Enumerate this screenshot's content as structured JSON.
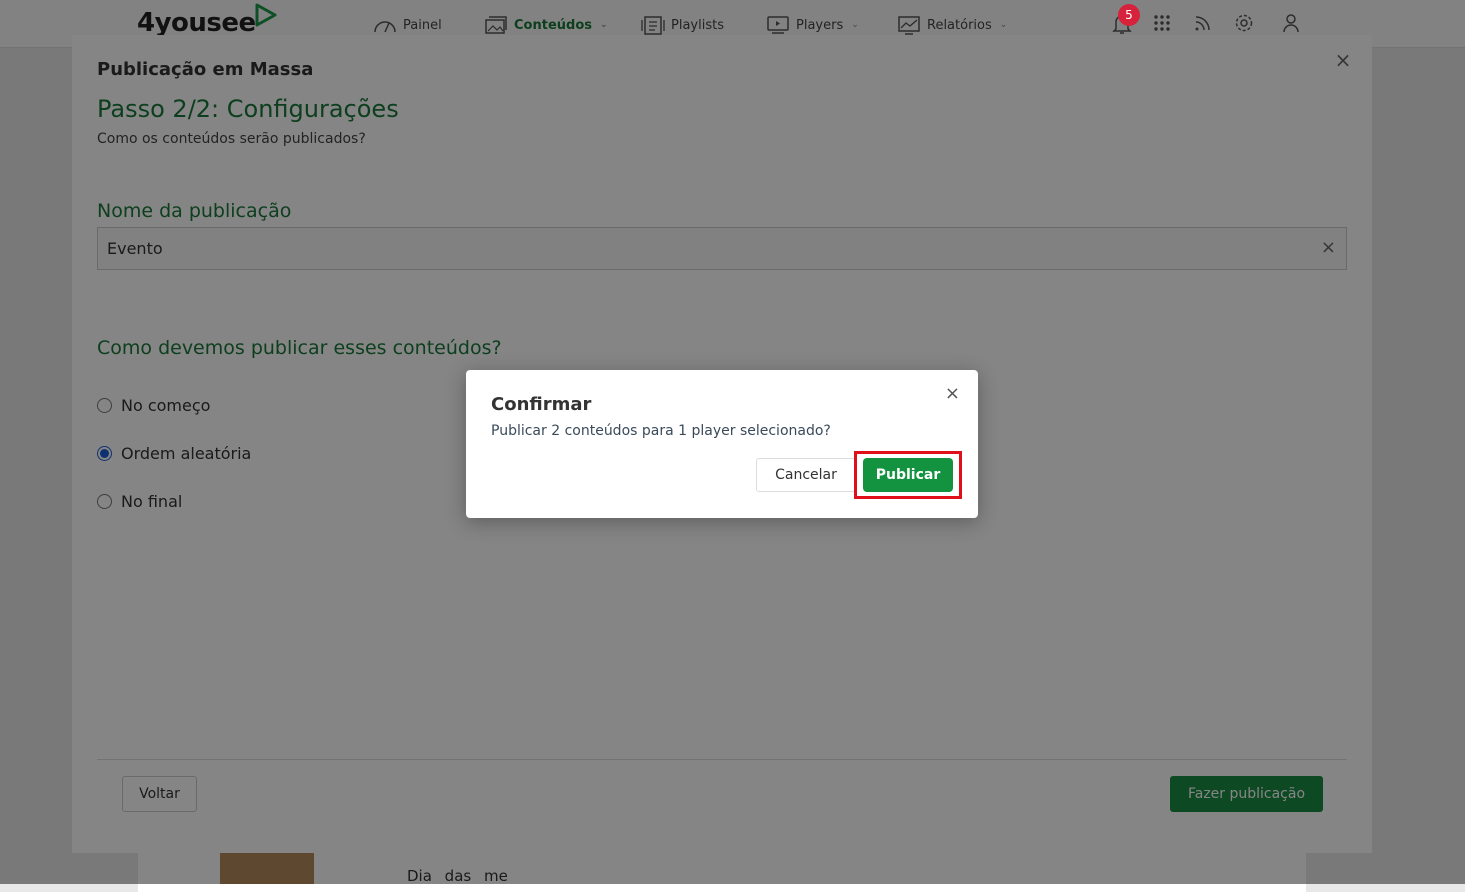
{
  "app": {
    "logo": "4yousee",
    "nav": [
      {
        "label": "Painel",
        "icon": "gauge-icon",
        "dropdown": false
      },
      {
        "label": "Conteúdos",
        "icon": "images-icon",
        "dropdown": true,
        "active": true
      },
      {
        "label": "Playlists",
        "icon": "playlist-icon",
        "dropdown": false
      },
      {
        "label": "Players",
        "icon": "monitor-icon",
        "dropdown": true
      },
      {
        "label": "Relatórios",
        "icon": "chart-icon",
        "dropdown": true
      }
    ],
    "notification_count": "5",
    "background_row_text": "Dia das me"
  },
  "modal": {
    "title": "Publicação em Massa",
    "step_title": "Passo 2/2: Configurações",
    "step_subtitle": "Como os conteúdos serão publicados?",
    "name_label": "Nome da publicação",
    "name_value": "Evento",
    "order_label": "Como devemos publicar esses conteúdos?",
    "options": [
      {
        "label": "No começo",
        "checked": false
      },
      {
        "label": "Ordem aleatória",
        "checked": true
      },
      {
        "label": "No final",
        "checked": false
      }
    ],
    "back_label": "Voltar",
    "submit_label": "Fazer publicação"
  },
  "confirm": {
    "title": "Confirmar",
    "message": "Publicar 2 conteúdos para 1 player selecionado?",
    "cancel_label": "Cancelar",
    "confirm_label": "Publicar"
  },
  "colors": {
    "brand_green": "#1a7a3a",
    "button_green": "#13933f",
    "highlight_red": "#e0101a",
    "radio_blue": "#1b5fd6"
  }
}
